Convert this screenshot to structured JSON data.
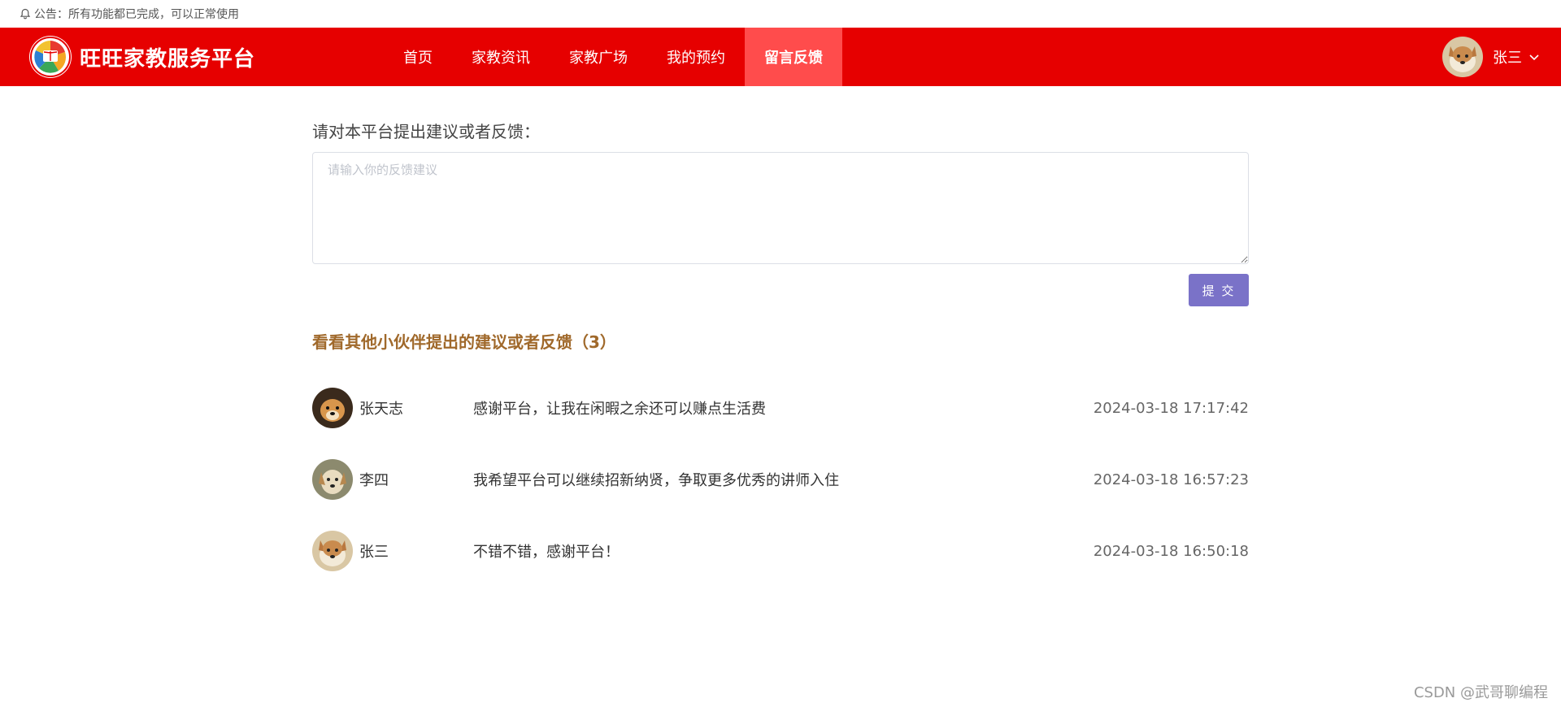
{
  "notice": {
    "icon": "bell-icon",
    "text": "公告：所有功能都已完成，可以正常使用"
  },
  "navbar": {
    "background": "#e60000",
    "brand": {
      "logo_icon": "book-globe-logo",
      "name": "旺旺家教服务平台"
    },
    "items": [
      {
        "label": "首页",
        "active": false
      },
      {
        "label": "家教资讯",
        "active": false
      },
      {
        "label": "家教广场",
        "active": false
      },
      {
        "label": "我的预约",
        "active": false
      },
      {
        "label": "留言反馈",
        "active": true
      }
    ],
    "user": {
      "name": "张三",
      "avatar": "dog-avatar",
      "dropdown_icon": "chevron-down-icon"
    }
  },
  "feedback": {
    "prompt": "请对本平台提出建议或者反馈：",
    "placeholder": "请输入你的反馈建议",
    "value": "",
    "submit_label": "提 交",
    "submit_color": "#7a72c8"
  },
  "others": {
    "title": "看看其他小伙伴提出的建议或者反馈（3）",
    "title_color": "#a0692b",
    "items": [
      {
        "name": "张天志",
        "message": "感谢平台，让我在闲暇之余还可以赚点生活费",
        "time": "2024-03-18 17:17:42"
      },
      {
        "name": "李四",
        "message": "我希望平台可以继续招新纳贤，争取更多优秀的讲师入住",
        "time": "2024-03-18 16:57:23"
      },
      {
        "name": "张三",
        "message": "不错不错，感谢平台！",
        "time": "2024-03-18 16:50:18"
      }
    ]
  },
  "watermark": "CSDN @武哥聊编程"
}
